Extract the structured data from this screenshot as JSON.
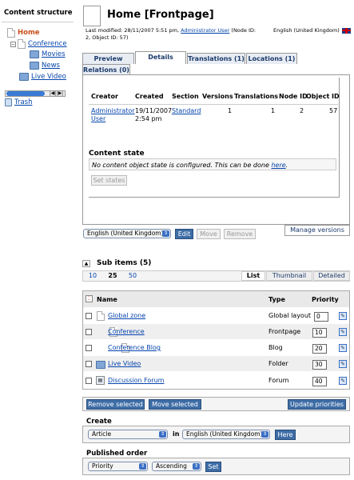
{
  "left": {
    "title": "Content structure",
    "tree": [
      {
        "label": "Home",
        "active": true
      },
      {
        "label": "Conference"
      },
      {
        "label": "Movies"
      },
      {
        "label": "News"
      },
      {
        "label": "Live Video"
      }
    ],
    "trash": "Trash"
  },
  "header": {
    "title": "Home [Frontpage]",
    "meta_prefix": "Last modified: 28/11/2007 5:51 pm,",
    "meta_user": "Administrator User",
    "meta_suffix": "(Node ID: 2, Object ID: 57)",
    "language": "English (United Kingdom)"
  },
  "tabs": [
    {
      "label": "Preview"
    },
    {
      "label": "Details",
      "selected": true
    },
    {
      "label": "Translations (1)"
    },
    {
      "label": "Locations (1)"
    },
    {
      "label": "Relations (0)"
    }
  ],
  "details": {
    "headers": [
      "Creator",
      "Created",
      "Section",
      "Versions",
      "Translations",
      "Node ID",
      "Object ID"
    ],
    "creator": "Administrator User",
    "created": "19/11/2007 2:54 pm",
    "section": "Standard",
    "versions": "1",
    "translations": "1",
    "node_id": "2",
    "object_id": "57"
  },
  "content_state": {
    "title": "Content state",
    "message": "No content object state is configured. This can be done",
    "link": "here",
    "set_states": "Set states"
  },
  "actions": {
    "language": "English (United Kingdom)",
    "edit": "Edit",
    "move": "Move",
    "remove": "Remove",
    "manage_versions": "Manage versions"
  },
  "sub_items": {
    "title": "Sub items (5)",
    "page_sizes": [
      "10",
      "25",
      "50"
    ],
    "views": [
      "List",
      "Thumbnail",
      "Detailed"
    ],
    "col_name": "Name",
    "col_type": "Type",
    "col_priority": "Priority",
    "rows": [
      {
        "name": "Global zone",
        "type": "Global layout",
        "priority": "0",
        "icon": "doc"
      },
      {
        "name": "Conference",
        "type": "Frontpage",
        "priority": "10",
        "icon": "doc"
      },
      {
        "name": "Conference Blog",
        "type": "Blog",
        "priority": "20",
        "icon": "doc"
      },
      {
        "name": "Live Video",
        "type": "Folder",
        "priority": "30",
        "icon": "folder"
      },
      {
        "name": "Discussion Forum",
        "type": "Forum",
        "priority": "40",
        "icon": "forum"
      }
    ],
    "remove_selected": "Remove selected",
    "move_selected": "Move selected",
    "update_priorities": "Update priorities"
  },
  "create": {
    "title": "Create",
    "class": "Article",
    "in": "in",
    "language": "English (United Kingdom)",
    "here": "Here"
  },
  "order": {
    "title": "Published order",
    "field": "Priority",
    "direction": "Ascending",
    "set": "Set"
  }
}
